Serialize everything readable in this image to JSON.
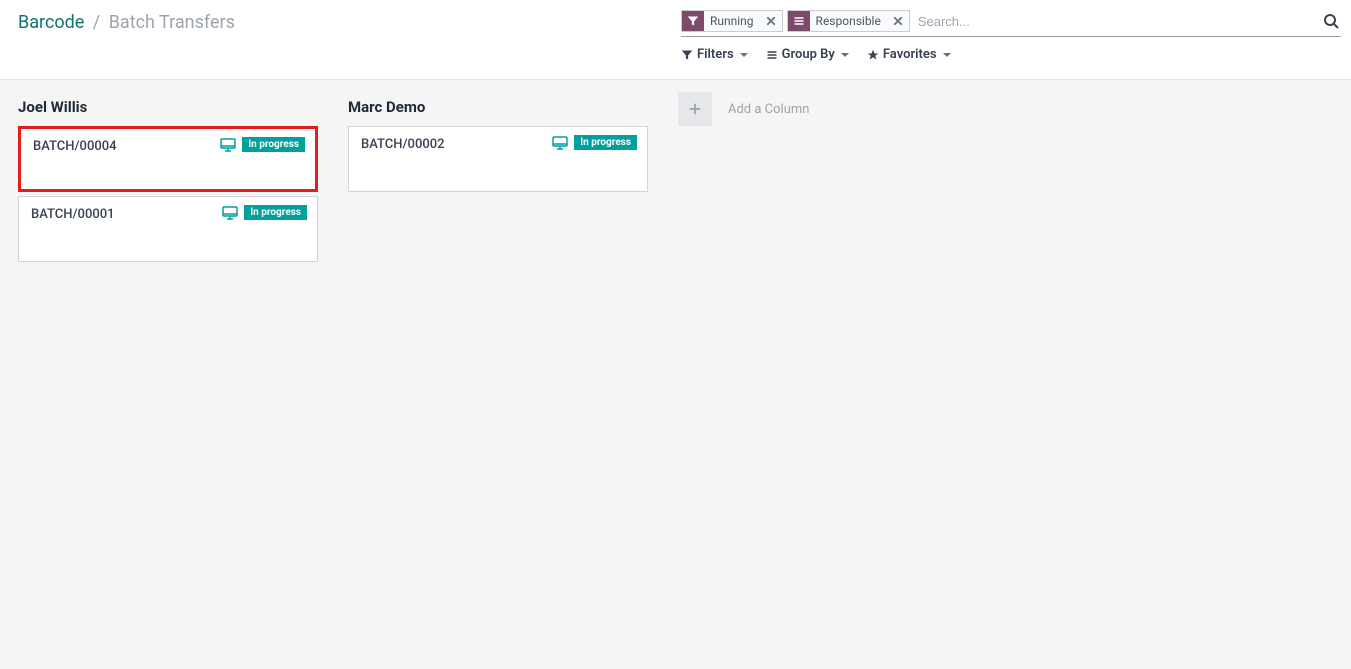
{
  "breadcrumb": {
    "root": "Barcode",
    "separator": "/",
    "current": "Batch Transfers"
  },
  "search": {
    "facets": [
      {
        "type": "filter",
        "label": "Running"
      },
      {
        "type": "group",
        "label": "Responsible"
      }
    ],
    "placeholder": "Search..."
  },
  "toolbar": {
    "filters_label": "Filters",
    "groupby_label": "Group By",
    "favorites_label": "Favorites"
  },
  "kanban": {
    "columns": [
      {
        "title": "Joel Willis",
        "cards": [
          {
            "name": "BATCH/00004",
            "status": "In progress",
            "highlight": true
          },
          {
            "name": "BATCH/00001",
            "status": "In progress",
            "highlight": false
          }
        ]
      },
      {
        "title": "Marc Demo",
        "cards": [
          {
            "name": "BATCH/00002",
            "status": "In progress",
            "highlight": false
          }
        ]
      }
    ],
    "add_column_label": "Add a Column"
  }
}
